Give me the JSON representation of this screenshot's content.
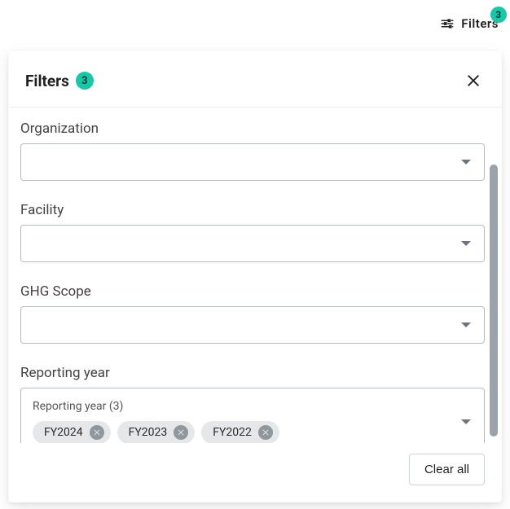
{
  "trigger": {
    "label": "Filters",
    "count": "3"
  },
  "panel": {
    "title": "Filters",
    "count": "3",
    "close_label": "Close",
    "clear_all_label": "Clear all"
  },
  "fields": {
    "organization": {
      "label": "Organization",
      "value": ""
    },
    "facility": {
      "label": "Facility",
      "value": ""
    },
    "ghg_scope": {
      "label": "GHG Scope",
      "value": ""
    },
    "reporting_year": {
      "label": "Reporting year",
      "inner_label": "Reporting year (3)",
      "chips": [
        {
          "label": "FY2024"
        },
        {
          "label": "FY2023"
        },
        {
          "label": "FY2022"
        }
      ]
    }
  }
}
